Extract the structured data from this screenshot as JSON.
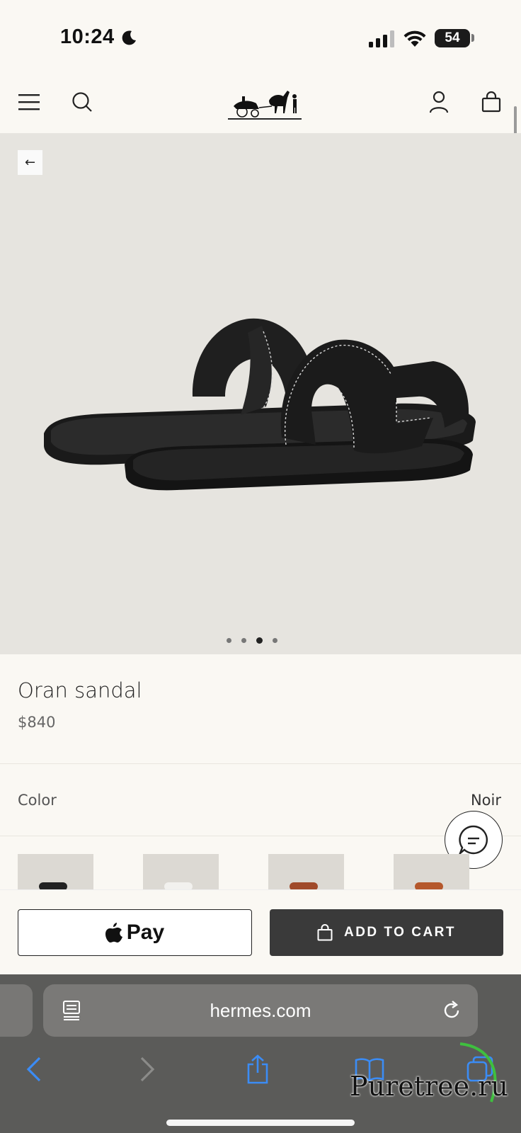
{
  "status_bar": {
    "time": "10:24",
    "battery": "54"
  },
  "header": {
    "brand_logo": "carriage-logo"
  },
  "product": {
    "name": "Oran sandal",
    "price": "$840",
    "image_pager": {
      "count": 4,
      "active_index": 2
    },
    "color_label": "Color",
    "color_value": "Noir",
    "swatch_count": 4
  },
  "actions": {
    "apple_pay_label": "Pay",
    "add_to_cart_label": "ADD TO CART"
  },
  "browser": {
    "url": "hermes.com"
  },
  "watermark": {
    "text": "Puretree.ru"
  },
  "colors": {
    "page_bg": "#faf8f3",
    "hero_bg": "#e6e4df",
    "cart_button": "#3a3a3a",
    "safari_bar": "#5b5b59",
    "link_blue": "#3b8cf5"
  }
}
